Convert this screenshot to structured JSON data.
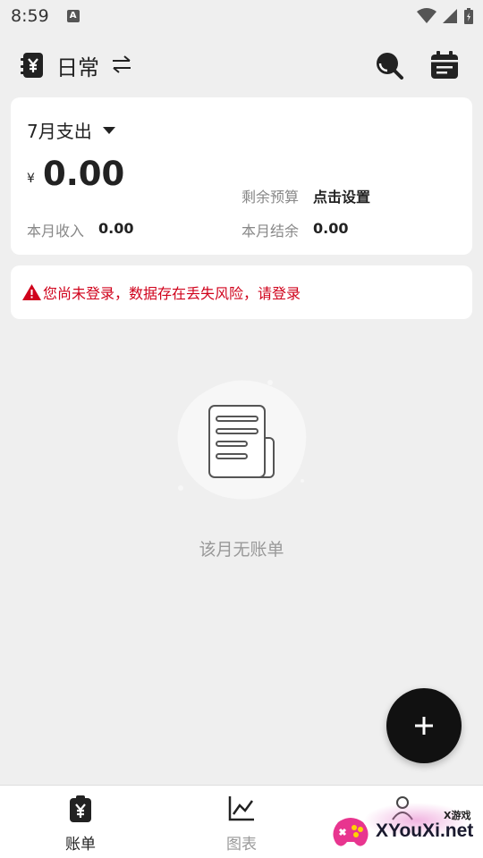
{
  "status_bar": {
    "time": "8:59",
    "notification_badge": "A"
  },
  "app_bar": {
    "book_name": "日常",
    "icons": [
      "yen-book-icon",
      "switch-arrows-icon",
      "search-icon",
      "calendar-icon"
    ]
  },
  "summary": {
    "month_label": "7月支出",
    "currency": "¥",
    "expense": "0.00",
    "budget_label": "剩余预算",
    "budget_action": "点击设置",
    "income_label": "本月收入",
    "income_value": "0.00",
    "balance_label": "本月结余",
    "balance_value": "0.00"
  },
  "warning": {
    "text": "您尚未登录，数据存在丢失风险，请登录",
    "color": "#d0021b"
  },
  "empty_state": {
    "text": "该月无账单"
  },
  "bottom_nav": {
    "items": [
      {
        "label": "账单",
        "icon": "yen-clipboard-icon",
        "active": true
      },
      {
        "label": "图表",
        "icon": "line-chart-icon",
        "active": false
      },
      {
        "label": "",
        "icon": "user-icon",
        "active": false
      }
    ]
  },
  "watermark": {
    "small": "X游戏",
    "main": "XYouXi.net"
  }
}
